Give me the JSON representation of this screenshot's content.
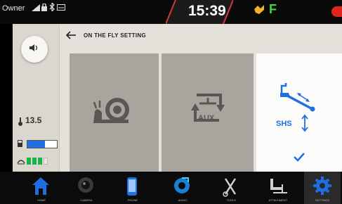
{
  "status_bar": {
    "owner_label": "Owner",
    "time": "15:39",
    "gear_indicator": "F",
    "colors": {
      "warn": "#f0b126",
      "gear": "#4ad04a",
      "alert": "#e0251a"
    }
  },
  "sidebar": {
    "volume_icon": "speaker-icon",
    "temperature_value": "13.5",
    "fuel_level_fraction": 0.6,
    "battery_segments_on": 3,
    "battery_segments_total": 4
  },
  "header": {
    "back_icon": "back-arrow-icon",
    "title": "ON THE FLY SETTING"
  },
  "tiles": [
    {
      "name": "slow-mode",
      "icon": "snail-icon",
      "label": ""
    },
    {
      "name": "aux",
      "icon": "aux-cycle-icon",
      "label": "AUX"
    },
    {
      "name": "shs",
      "icon": "shs-icon",
      "label": "SHS",
      "selected": true
    }
  ],
  "dock": {
    "items": [
      {
        "icon": "home-icon",
        "label": "HOME"
      },
      {
        "icon": "camera-icon",
        "label": "CAMERA"
      },
      {
        "icon": "phone-icon",
        "label": "PHONE"
      },
      {
        "icon": "media-icon",
        "label": "AUDIO"
      },
      {
        "icon": "tools-icon",
        "label": "TOOLS"
      },
      {
        "icon": "forklift-icon",
        "label": "ATTACHMENT"
      },
      {
        "icon": "settings-icon",
        "label": "SETTINGS",
        "active": true
      }
    ]
  }
}
